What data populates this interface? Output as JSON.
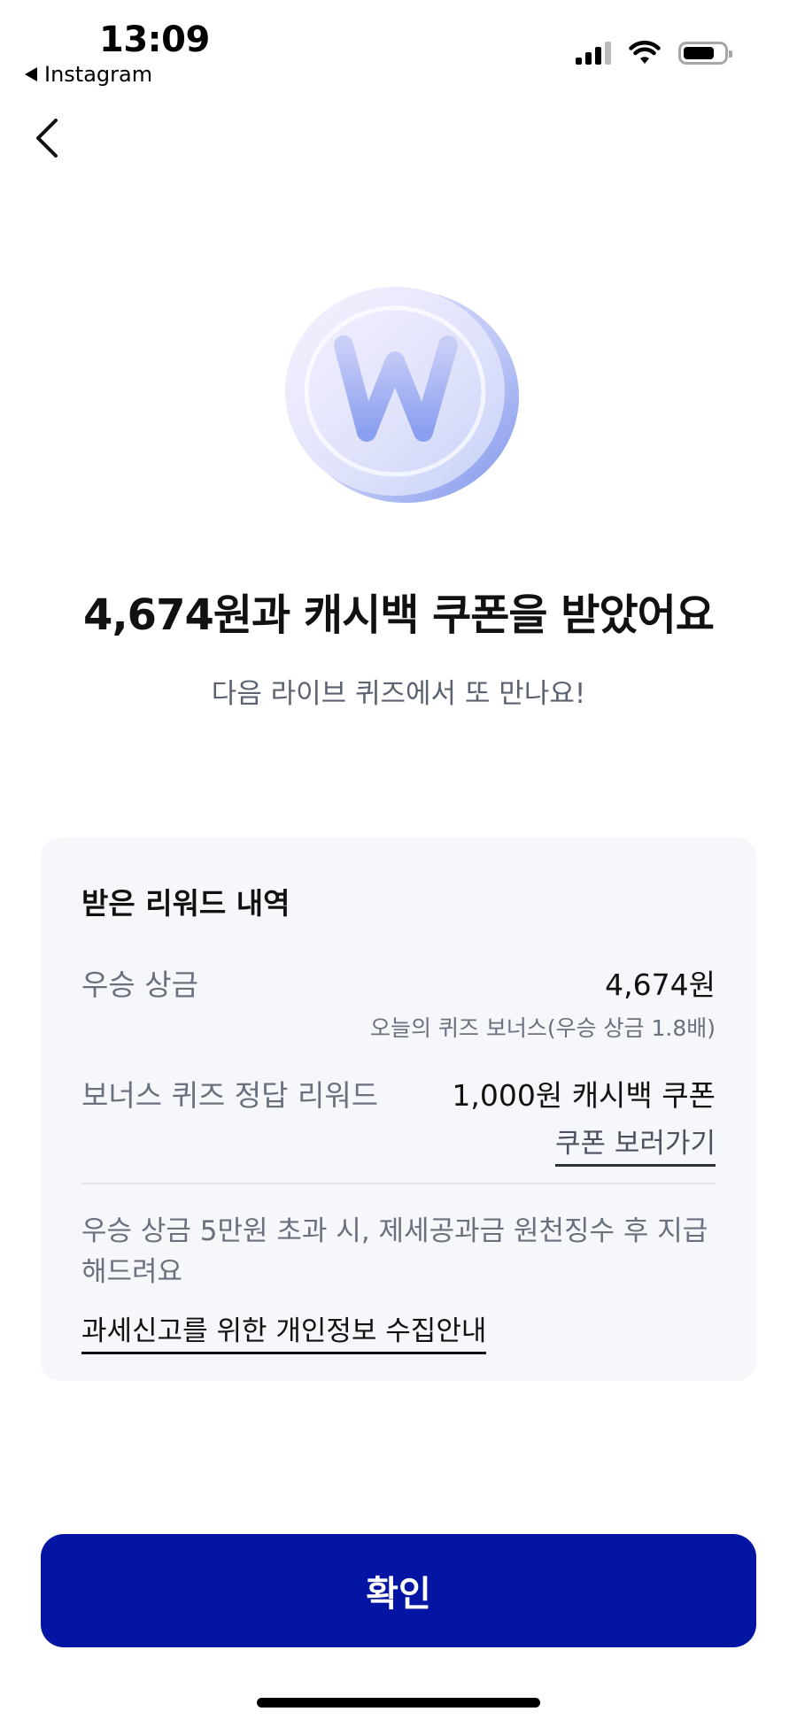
{
  "status_bar": {
    "time": "13:09",
    "back_app": "Instagram",
    "icons": [
      "cellular-signal-icon",
      "wifi-icon",
      "battery-icon"
    ]
  },
  "nav": {
    "back_icon": "chevron-left-icon"
  },
  "hero": {
    "icon": "won-coin-icon",
    "headline": "4,674원과 캐시백 쿠폰을 받았어요",
    "subline": "다음 라이브 퀴즈에서 또 만나요!"
  },
  "rewards": {
    "title": "받은 리워드 내역",
    "prize_label": "우승 상금",
    "prize_value": "4,674원",
    "prize_note": "오늘의 퀴즈 보너스(우승 상금 1.8배)",
    "bonus_label": "보너스 퀴즈 정답 리워드",
    "bonus_value": "1,000원 캐시백 쿠폰",
    "coupon_link": "쿠폰 보러가기",
    "notice": "우승 상금 5만원 초과 시, 제세공과금 원천징수 후 지급 해드려요",
    "privacy_link": "과세신고를 위한 개인정보 수집안내"
  },
  "confirm_button": {
    "label": "확인"
  },
  "colors": {
    "primary": "#0414a3",
    "card_bg": "#f6f7fb",
    "muted_text": "#6a707c"
  }
}
